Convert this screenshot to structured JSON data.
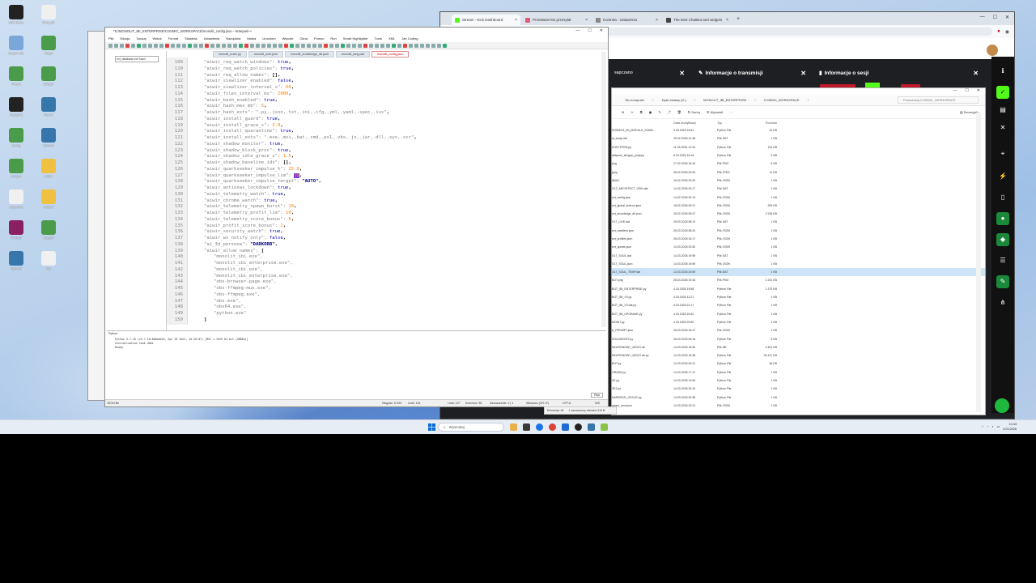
{
  "desktop": {
    "icons": [
      {
        "label": "OBS Studio",
        "color": "#222"
      },
      {
        "label": "Nowy plik",
        "color": "#f0f0f0"
      },
      {
        "label": "Recycle Bin",
        "color": "#7aa6d8"
      },
      {
        "label": "Skrypt",
        "color": "#4a9c4a"
      },
      {
        "label": "Projekt",
        "color": "#4a9c4a"
      },
      {
        "label": "Skrypt2",
        "color": "#4a9c4a"
      },
      {
        "label": "Narzędzie",
        "color": "#222"
      },
      {
        "label": "Python",
        "color": "#3776ab"
      },
      {
        "label": "Konfig",
        "color": "#4a9c4a"
      },
      {
        "label": "Python2",
        "color": "#3776ab"
      },
      {
        "label": "Skrypt3",
        "color": "#4a9c4a"
      },
      {
        "label": "Folder",
        "color": "#f0c040"
      },
      {
        "label": "Dokument",
        "color": "#f0f0f0"
      },
      {
        "label": "Folder2",
        "color": "#f0c040"
      },
      {
        "label": "WinRAR",
        "color": "#8a2060"
      },
      {
        "label": "Skrypt4",
        "color": "#4a9c4a"
      },
      {
        "label": "Python3",
        "color": "#3776ab"
      },
      {
        "label": "Plik",
        "color": "#f0f0f0"
      }
    ]
  },
  "browser": {
    "tabs": [
      {
        "label": "Stream - Kick Dashboard",
        "color": "#53fc18"
      },
      {
        "label": "Przesłanie kto przesyłał",
        "color": "#e05a7a"
      },
      {
        "label": "Kontrola - ustawienia",
        "color": "#888"
      },
      {
        "label": "The best ChatBot and widgets",
        "color": "#444"
      }
    ],
    "panels": [
      {
        "title": "Informacje o transmisji"
      },
      {
        "title": "Informacje o sesji"
      }
    ]
  },
  "explorer": {
    "breadcrumbs": [
      "Ten komputer",
      "Dysk lokalny (D:)",
      "MONOLIT_IBI_ENTERPRISE",
      "COSMIC_WORKSPACE"
    ],
    "search_placeholder": "Przeszukaj COSMIC_WORKSPACE",
    "toolbar": {
      "sort": "Sortuj",
      "view": "Wyświetl",
      "details": "Szczegóły"
    },
    "columns": {
      "date": "Data modyfikacji",
      "type": "Typ",
      "size": "Rozmiar"
    },
    "rows": [
      {
        "name": "KOSMOS_IBI_MODULE_KOMO...",
        "date": "9.03.2026 16:51",
        "type": "Python File",
        "size": "32 KB"
      },
      {
        "name": "st_swap.dat",
        "date": "25.02.2026 21:36",
        "type": "Plik DAT",
        "size": "1 KB"
      },
      {
        "name": "KOSYSTEM.py",
        "date": "11.03.2026 12:04",
        "type": "Python File",
        "size": "102 KB"
      },
      {
        "name": "aktywne_skrypty_porty.py",
        "date": "6.03.2026 16:16",
        "type": "Python File",
        "size": "9 KB"
      },
      {
        "name": "png",
        "date": "27.02.2026 16:44",
        "type": "Plik PNG",
        "size": "6 KB"
      },
      {
        "name": "jpeg",
        "date": "26.02.2026 20:09",
        "type": "Plik JPEG",
        "size": "11 KB"
      },
      {
        "name": "ABAC",
        "date": "16.02.2026 20:20",
        "type": "Plik JSON",
        "size": "1 KB"
      },
      {
        "name": "OLT_ARCHITECT_VEIN.dat",
        "date": "14.02.2026 20:17",
        "type": "Plik DAT",
        "size": "1 KB"
      },
      {
        "name": "ext_config.json",
        "date": "14.02.2026 20:13",
        "type": "Plik JSON",
        "size": "1 KB"
      },
      {
        "name": "ext_global_lexicon.json",
        "date": "18.02.2026 09:21",
        "type": "Plik JSON",
        "size": "209 KB"
      },
      {
        "name": "ext_knowledge_db.json",
        "date": "26.02.2026 09:47",
        "type": "Plik JSON",
        "size": "2 245 KB"
      },
      {
        "name": "OLT_LIVE.dat",
        "date": "26.03.2026 08:12",
        "type": "Plik DAT",
        "size": "1 KB"
      },
      {
        "name": "ext_manifest.json",
        "date": "26.03.2026 08:20",
        "type": "Plik JSON",
        "size": "1 KB"
      },
      {
        "name": "ext_profiles.json",
        "date": "26.03.2026 16:17",
        "type": "Plik JSON",
        "size": "1 KB"
      },
      {
        "name": "ext_quests.json",
        "date": "13.03.2026 22:52",
        "type": "Plik JSON",
        "size": "1 KB"
      },
      {
        "name": "OLT_SOUL.dat",
        "date": "14.03.2026 19:59",
        "type": "Plik DAT",
        "size": "1 KB"
      },
      {
        "name": "OLT_SOUL.json",
        "date": "14.03.2026 19:59",
        "type": "Plik JSON",
        "size": "1 KB"
      },
      {
        "name": "OLT_SOUL_TEMP.dat",
        "date": "13.03.2026 20:59",
        "type": "Plik DAT",
        "size": "1 KB",
        "selected": true
      },
      {
        "name": "BOT.png",
        "date": "26.03.2026 19:44",
        "type": "Plik PNG",
        "size": "1 241 KB"
      },
      {
        "name": "BOT_IBI_ENTERPRISE.py",
        "date": "4.03.2026 19:58",
        "type": "Python File",
        "size": "1 379 KB"
      },
      {
        "name": "BOT_IBI_V3.py",
        "date": "4.03.2026 11:21",
        "type": "Python File",
        "size": "1 KB"
      },
      {
        "name": "BOT_IBI_V3.dat.py",
        "date": "4.03.2026 21:17",
        "type": "Python File",
        "size": "1 KB"
      },
      {
        "name": "BOT_IBI_UPGRADE.py",
        "date": "4.03.2026 16:40",
        "type": "Python File",
        "size": "1 KB"
      },
      {
        "name": "MONIT.py",
        "date": "4.03.2026 20:50",
        "type": "Python File",
        "size": "1 KB"
      },
      {
        "name": "A_PROMPT.json",
        "date": "26.03.2026 15:27",
        "type": "Plik JSON",
        "size": "1 KB"
      },
      {
        "name": "SOULBOOST.py",
        "date": "26.03.2026 09:16",
        "type": "Python File",
        "size": "5 KB"
      },
      {
        "name": "NEURONOWY_MOZG.db",
        "date": "14.03.2026 16:50",
        "type": "Plik DB",
        "size": "4 401 KB"
      },
      {
        "name": "NEURONOWY_MOZG.db.py",
        "date": "14.03.2026 15:38",
        "type": "Python File",
        "size": "34 147 KB"
      },
      {
        "name": "BOT.py",
        "date": "14.03.2026 00:21",
        "type": "Python File",
        "size": "46 KB"
      },
      {
        "name": "GRADE.py",
        "date": "14.03.2026 17:11",
        "type": "Python File",
        "size": "1 KB"
      },
      {
        "name": "ZE.py",
        "date": "14.03.2026 14:53",
        "type": "Python File",
        "size": "1 KB"
      },
      {
        "name": "ZE2.py",
        "date": "14.03.2026 20:10",
        "type": "Python File",
        "size": "1 KB"
      },
      {
        "name": "NARZEDZI_OGOLE.py",
        "date": "14.03.2026 20:38",
        "type": "Python File",
        "size": "1 KB"
      },
      {
        "name": "amed_mon.json",
        "date": "14.03.2026 20:21",
        "type": "Plik JSON",
        "size": "1 KB"
      }
    ],
    "status": {
      "count": "Elementy: 46",
      "selected": "1 zaznaczony element 419 B"
    }
  },
  "notepad": {
    "title": "*D:\\MONOLIT_IBI_ENTERPRISE\\COSMIC_WORKSPACE\\monolit_config.json - Notepad++",
    "menu": [
      "Plik",
      "Edycja",
      "Szukaj",
      "Widok",
      "Format",
      "Składnia",
      "Ustawienia",
      "Narzędzia",
      "Makra",
      "Uruchom",
      "Wtyczki",
      "Okna",
      "Pomoc",
      "Run",
      "Smart Highlighter",
      "Tools",
      "XML",
      "Jan Coding"
    ],
    "tabs": [
      "monolit_brain.py",
      "monolit_soul.json",
      "monolit_knowledge_db.json",
      "monolit_lang.dat",
      "monolit_config.json"
    ],
    "side_node": "ext_database.ext Kazd",
    "side_tab": "Tags",
    "lines": [
      {
        "n": "109",
        "indent": 2,
        "key": "aiwir_req_watch_windows",
        "val": "true",
        "kind": "k"
      },
      {
        "n": "110",
        "indent": 2,
        "key": "aiwir_req_watch_policies",
        "val": "true",
        "kind": "k"
      },
      {
        "n": "111",
        "indent": 2,
        "key": "aiwir_req_allow_names",
        "val": "[]",
        "kind": "p"
      },
      {
        "n": "112",
        "indent": 2,
        "key": "aiwir_siewlizer_enabled",
        "val": "false",
        "kind": "k"
      },
      {
        "n": "113",
        "indent": 2,
        "key": "aiwir_siewlizer_interval_s",
        "val": "60",
        "kind": "n"
      },
      {
        "n": "114",
        "indent": 2,
        "key": "aiwir_files_interval_ms",
        "val": "2000",
        "kind": "n"
      },
      {
        "n": "115",
        "indent": 2,
        "key": "aiwir_bash_enabled",
        "val": "true",
        "kind": "k"
      },
      {
        "n": "116",
        "indent": 2,
        "key": "aiwir_hash_max_mb",
        "val": "5",
        "kind": "n"
      },
      {
        "n": "117",
        "indent": 2,
        "key": "aiwir_hash_exts",
        "val": "\".py,.json,.txt,.ini,.cfg,.yml,.yaml,.spec,.iss\"",
        "kind": "s"
      },
      {
        "n": "118",
        "indent": 2,
        "key": "aiwir_install_guard",
        "val": "true",
        "kind": "k"
      },
      {
        "n": "119",
        "indent": 2,
        "key": "aiwir_install_grace_s",
        "val": "2.0",
        "kind": "n"
      },
      {
        "n": "120",
        "indent": 2,
        "key": "aiwir_install_quarantine",
        "val": "true",
        "kind": "k"
      },
      {
        "n": "121",
        "indent": 2,
        "key": "aiwir_install_exts",
        "val": "\".exe,.msi,.bat,.cmd,.ps1,.vbs,.js,.jar,.dll,.sys,.scr\"",
        "kind": "s"
      },
      {
        "n": "122",
        "indent": 2,
        "key": "aiwir_shadow_monitor",
        "val": "true",
        "kind": "k"
      },
      {
        "n": "123",
        "indent": 2,
        "key": "aiwir_shadow_block_proc",
        "val": "true",
        "kind": "k"
      },
      {
        "n": "124",
        "indent": 2,
        "key": "aiwir_shadow_idle_grace_s",
        "val": "1.5",
        "kind": "n"
      },
      {
        "n": "125",
        "indent": 2,
        "key": "aiwir_shadow_baseline_ids",
        "val": "[]",
        "kind": "p"
      },
      {
        "n": "126",
        "indent": 2,
        "key": "aiwir_quarkseeker_impulse_%",
        "val": "25.0",
        "kind": "n"
      },
      {
        "n": "127",
        "indent": 2,
        "key": "aiwir_quarkseeker_impulse_lim",
        "val": "10",
        "kind": "hl"
      },
      {
        "n": "128",
        "indent": 2,
        "key": "aiwir_quarkseeker_impulse_target",
        "val": "\"AUTO\"",
        "kind": "v"
      },
      {
        "n": "129",
        "indent": 2,
        "key": "aiwir_antionas_lockdown",
        "val": "true",
        "kind": "k"
      },
      {
        "n": "130",
        "indent": 2,
        "key": "aiwir_telemetry_watch",
        "val": "true",
        "kind": "k"
      },
      {
        "n": "131",
        "indent": 2,
        "key": "aiwir_chrome_watch",
        "val": "true",
        "kind": "k"
      },
      {
        "n": "132",
        "indent": 2,
        "key": "aiwir_telemetry_spawn_burst",
        "val": "10",
        "kind": "n"
      },
      {
        "n": "133",
        "indent": 2,
        "key": "aiwir_telemetry_profit_lim",
        "val": "10",
        "kind": "n"
      },
      {
        "n": "134",
        "indent": 2,
        "key": "aiwir_telemetry_score_bonus",
        "val": "5",
        "kind": "n"
      },
      {
        "n": "135",
        "indent": 2,
        "key": "aiwir_profit_score_bonus",
        "val": "2",
        "kind": "n"
      },
      {
        "n": "136",
        "indent": 2,
        "key": "aiwir_security_watch",
        "val": "true",
        "kind": "k"
      },
      {
        "n": "137",
        "indent": 2,
        "key": "aiwir_ws_notify_only",
        "val": "false",
        "kind": "k"
      },
      {
        "n": "138",
        "indent": 2,
        "key": "ai_3d_persona",
        "val": "\"DARKORB\"",
        "kind": "v"
      },
      {
        "n": "139",
        "indent": 2,
        "key": "aiwir_allow_names",
        "val": "[",
        "kind": "p"
      },
      {
        "n": "140",
        "indent": 4,
        "raw": "\"monolit_ibi.exe\","
      },
      {
        "n": "141",
        "indent": 4,
        "raw": "\"monolit_ibi_enterprise.exe\","
      },
      {
        "n": "142",
        "indent": 4,
        "raw": "\"monolit_ibi.exe\","
      },
      {
        "n": "143",
        "indent": 4,
        "raw": "\"monolit_ibi_enterprise.exe\","
      },
      {
        "n": "144",
        "indent": 4,
        "raw": "\"obs-browser-page.exe\","
      },
      {
        "n": "145",
        "indent": 4,
        "raw": "\"obs-ffmpeg-mux.exe\","
      },
      {
        "n": "146",
        "indent": 4,
        "raw": "\"obs-ffmpeg.exe\","
      },
      {
        "n": "147",
        "indent": 4,
        "raw": "\"obs.exe\","
      },
      {
        "n": "148",
        "indent": 4,
        "raw": "\"obs64.exe\","
      },
      {
        "n": "149",
        "indent": 4,
        "raw": "\"python.exe\""
      },
      {
        "n": "150",
        "indent": 2,
        "raw": "]"
      }
    ],
    "console": [
      "Python 3.7.10 (v3.7.10:8d0ad22d, Apr 29 2023, 10:20:07) [MSC v.1929 64 bit (AMD64)]",
      "Initialisation took 49ms",
      "Ready."
    ],
    "console_run": "Run",
    "status": {
      "lang": "JSON file",
      "length": "Długość: 5 534",
      "lines": "Linie: 151",
      "pos": "Linia: 127",
      "col": "Kolumna: 38",
      "sel": "Zaznaczenie: 2 | 1",
      "eol": "Windows (CR LF)",
      "enc": "UTF-8",
      "ins": "INS"
    }
  },
  "taskbar": {
    "search_placeholder": "Wyszukaj",
    "time": "10:43",
    "date": "4.03.2026"
  }
}
